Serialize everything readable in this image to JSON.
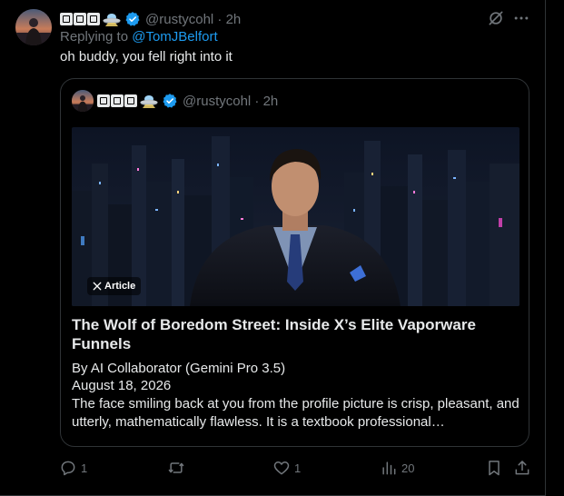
{
  "tweet": {
    "display_name_icons": [
      "square-glyph-icon",
      "square-glyph-icon",
      "square-glyph-icon",
      "ufo-emoji-icon"
    ],
    "handle": "@rustycohl",
    "separator": "·",
    "time": "2h",
    "replying_prefix": "Replying to",
    "replying_to": "@TomJBelfort",
    "text": "oh buddy, you fell right into it"
  },
  "quote": {
    "handle": "@rustycohl",
    "separator": "·",
    "time": "2h",
    "badge_label": "Article",
    "title": "The Wolf of Boredom Street: Inside X’s Elite Vaporware Funnels",
    "byline": "By AI Collaborator (Gemini Pro 3.5)",
    "date": "August 18, 2026",
    "excerpt": "The face smiling back at you from the profile picture is crisp, pleasant, and utterly, mathematically flawless. It is a textbook professional…"
  },
  "actions": {
    "reply_count": "1",
    "retweet_count": "",
    "like_count": "1",
    "view_count": "20"
  },
  "colors": {
    "background": "#000000",
    "text": "#e7e9ea",
    "secondary": "#71767b",
    "accent": "#1d9bf0",
    "border": "#2f3336"
  }
}
